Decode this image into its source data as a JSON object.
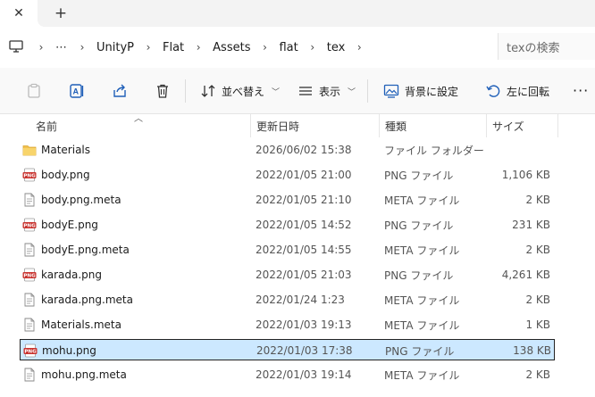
{
  "tabs": {
    "close_glyph": "✕",
    "new_tab_glyph": "+"
  },
  "address": {
    "more_label": "⋯",
    "crumbs": [
      "UnityP",
      "Flat",
      "Assets",
      "flat",
      "tex"
    ],
    "search_placeholder": "texの検索"
  },
  "toolbar": {
    "sort_label": "並べ替え",
    "view_label": "表示",
    "wallpaper_label": "背景に設定",
    "rotate_left_label": "左に回転",
    "more_label": "···"
  },
  "columns": {
    "name": "名前",
    "date": "更新日時",
    "type": "種類",
    "size": "サイズ"
  },
  "files": [
    {
      "name": "Materials",
      "date": "2026/06/02 15:38",
      "type": "ファイル フォルダー",
      "size": "",
      "icon": "folder-icon"
    },
    {
      "name": "body.png",
      "date": "2022/01/05 21:00",
      "type": "PNG ファイル",
      "size": "1,106 KB",
      "icon": "png-file-icon"
    },
    {
      "name": "body.png.meta",
      "date": "2022/01/05 21:10",
      "type": "META ファイル",
      "size": "2 KB",
      "icon": "document-icon"
    },
    {
      "name": "bodyE.png",
      "date": "2022/01/05 14:52",
      "type": "PNG ファイル",
      "size": "231 KB",
      "icon": "png-file-icon"
    },
    {
      "name": "bodyE.png.meta",
      "date": "2022/01/05 14:55",
      "type": "META ファイル",
      "size": "2 KB",
      "icon": "document-icon"
    },
    {
      "name": "karada.png",
      "date": "2022/01/05 21:03",
      "type": "PNG ファイル",
      "size": "4,261 KB",
      "icon": "png-file-icon"
    },
    {
      "name": "karada.png.meta",
      "date": "2022/01/24 1:23",
      "type": "META ファイル",
      "size": "2 KB",
      "icon": "document-icon"
    },
    {
      "name": "Materials.meta",
      "date": "2022/01/03 19:13",
      "type": "META ファイル",
      "size": "1 KB",
      "icon": "document-icon"
    },
    {
      "name": "mohu.png",
      "date": "2022/01/03 17:38",
      "type": "PNG ファイル",
      "size": "138 KB",
      "icon": "png-file-icon",
      "selected": true
    },
    {
      "name": "mohu.png.meta",
      "date": "2022/01/03 19:14",
      "type": "META ファイル",
      "size": "2 KB",
      "icon": "document-icon"
    }
  ],
  "colors": {
    "selection": "#cce8ff",
    "folder": "#f2c14e",
    "png_badge": "#c8322e"
  }
}
